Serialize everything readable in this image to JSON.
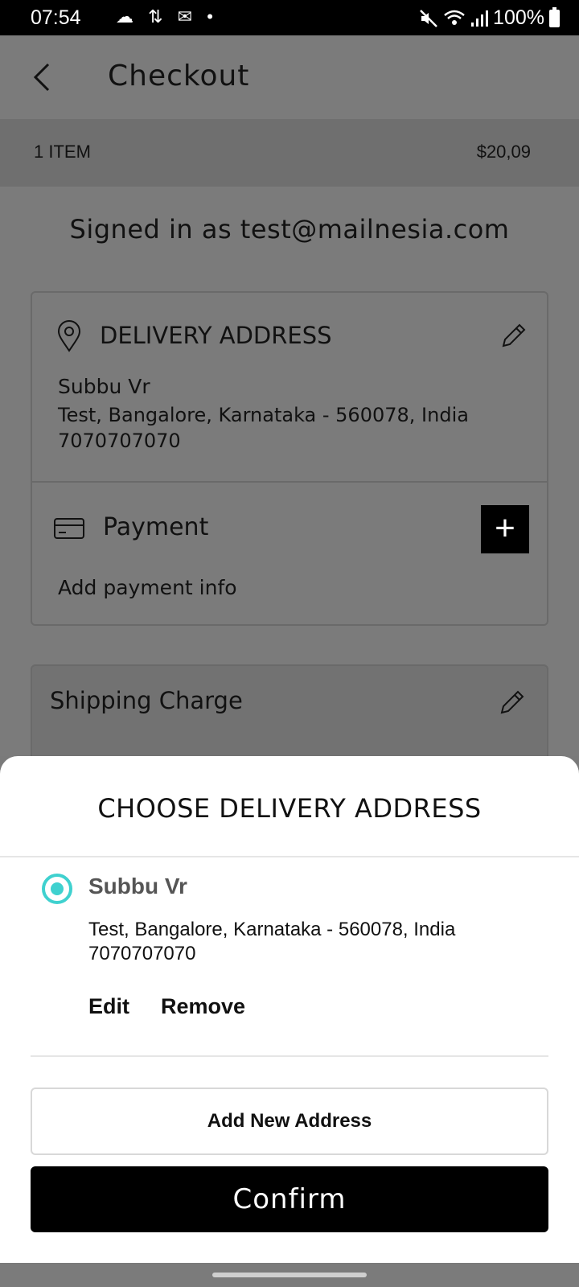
{
  "status_bar": {
    "time": "07:54",
    "notification_icons": "☁ ⇅ ✉ •",
    "battery": "100%"
  },
  "header": {
    "title": "Checkout",
    "back_icon": "chevron-left-icon"
  },
  "summary": {
    "items": "1 ITEM",
    "total": "$20,09"
  },
  "signed_in": "Signed in as test@mailnesia.com",
  "delivery": {
    "title": "DELIVERY ADDRESS",
    "name": "Subbu Vr",
    "address": "Test, Bangalore, Karnataka - 560078, India",
    "phone": "7070707070"
  },
  "payment": {
    "title": "Payment",
    "add_icon": "+",
    "info": "Add payment info"
  },
  "shipping": {
    "title": "Shipping Charge"
  },
  "sheet": {
    "title": "CHOOSE DELIVERY ADDRESS",
    "address": {
      "name": "Subbu Vr",
      "line": "Test, Bangalore, Karnataka - 560078, India",
      "phone": "7070707070",
      "selected": true
    },
    "edit_label": "Edit",
    "remove_label": "Remove",
    "add_new_label": "Add New Address",
    "confirm_label": "Confirm"
  },
  "colors": {
    "accent": "#3fd1cf",
    "overlay": "#7b7b7b"
  }
}
